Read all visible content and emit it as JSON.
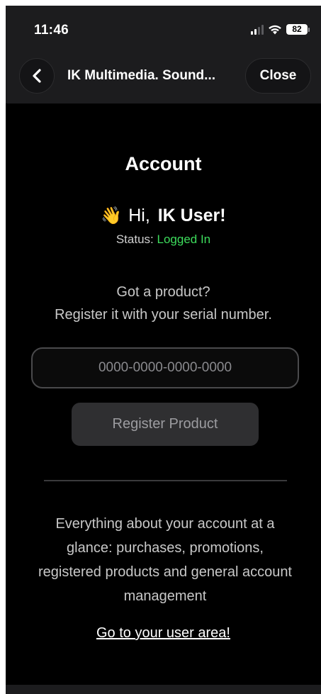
{
  "status_bar": {
    "time": "11:46",
    "battery": "82",
    "signal_icon": "signal-icon",
    "wifi_icon": "wifi-icon",
    "battery_icon": "battery-icon"
  },
  "nav": {
    "back_icon": "chevron-left-icon",
    "title": "IK Multimedia. Sound...",
    "close_label": "Close"
  },
  "account": {
    "title": "Account",
    "greeting_emoji": "👋",
    "greeting_hi": "Hi,",
    "user_name": "IK User!",
    "status_label": "Status:",
    "status_value": "Logged In",
    "status_color": "#3ddc5c"
  },
  "register": {
    "line1": "Got a product?",
    "line2": "Register it with your serial number.",
    "serial_placeholder": "0000-0000-0000-0000",
    "serial_value": "",
    "button_label": "Register Product"
  },
  "summary": {
    "description": "Everything about your account at a glance: purchases, promotions, registered products and general account management",
    "link_label": "Go to your user area!"
  }
}
